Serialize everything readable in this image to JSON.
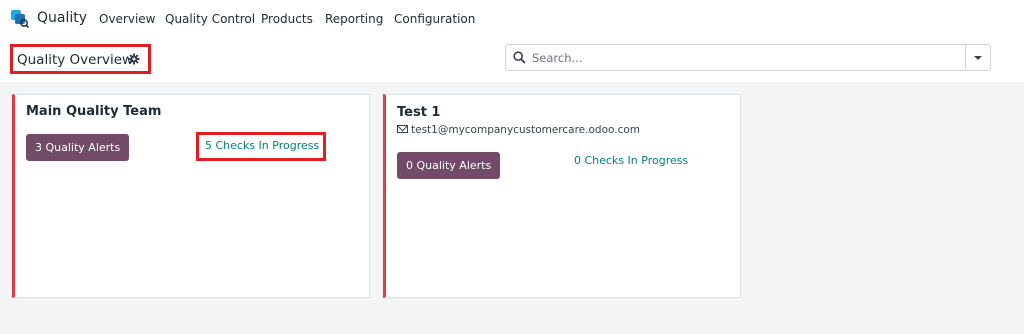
{
  "app": {
    "name": "Quality"
  },
  "nav": {
    "items": [
      {
        "label": "Overview"
      },
      {
        "label": "Quality Control"
      },
      {
        "label": "Products"
      },
      {
        "label": "Reporting"
      },
      {
        "label": "Configuration"
      }
    ]
  },
  "control": {
    "title": "Quality Overview",
    "search_placeholder": "Search..."
  },
  "teams": [
    {
      "name": "Main Quality Team",
      "alerts_label": "3 Quality Alerts",
      "checks_label": "5 Checks In Progress"
    },
    {
      "name": "Test 1",
      "email": "test1@mycompanycustomercare.odoo.com",
      "alerts_label": "0 Quality Alerts",
      "checks_label": "0 Checks In Progress"
    }
  ],
  "colors": {
    "brand": "#714b67",
    "link": "#017e84",
    "card_accent": "#e63946",
    "highlight": "#e11d22"
  },
  "icons": {
    "app_logo": "quality-app-icon",
    "settings": "gear-icon",
    "search": "search-icon",
    "dropdown": "caret-down-icon",
    "email": "envelope-icon"
  }
}
